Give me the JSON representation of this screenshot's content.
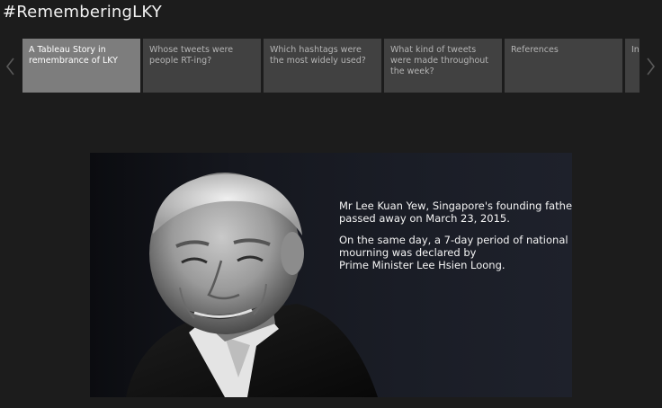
{
  "story": {
    "title": "#RememberingLKY"
  },
  "navigation": {
    "prev_icon": "chevron-left-icon",
    "next_icon": "chevron-right-icon",
    "active_color": "#7d7d7d",
    "inactive_color": "#414141",
    "points": [
      {
        "label": "A Tableau Story in remembrance of LKY",
        "active": true
      },
      {
        "label": "Whose tweets were people RT-ing?",
        "active": false
      },
      {
        "label": "Which hashtags were the most widely used?",
        "active": false
      },
      {
        "label": "What kind of tweets were made throughout the week?",
        "active": false
      },
      {
        "label": "References",
        "active": false
      },
      {
        "label": "In Ye",
        "active": false
      }
    ]
  },
  "dashboard": {
    "paragraph1": {
      "line1": "Mr Lee Kuan Yew, Singapore's founding father",
      "line2": "passed away on March 23, 2015."
    },
    "paragraph2": {
      "line1": "On the same day, a 7-day period of national",
      "line2": "mourning was declared by",
      "line3": "Prime Minister Lee Hsien Loong."
    }
  }
}
